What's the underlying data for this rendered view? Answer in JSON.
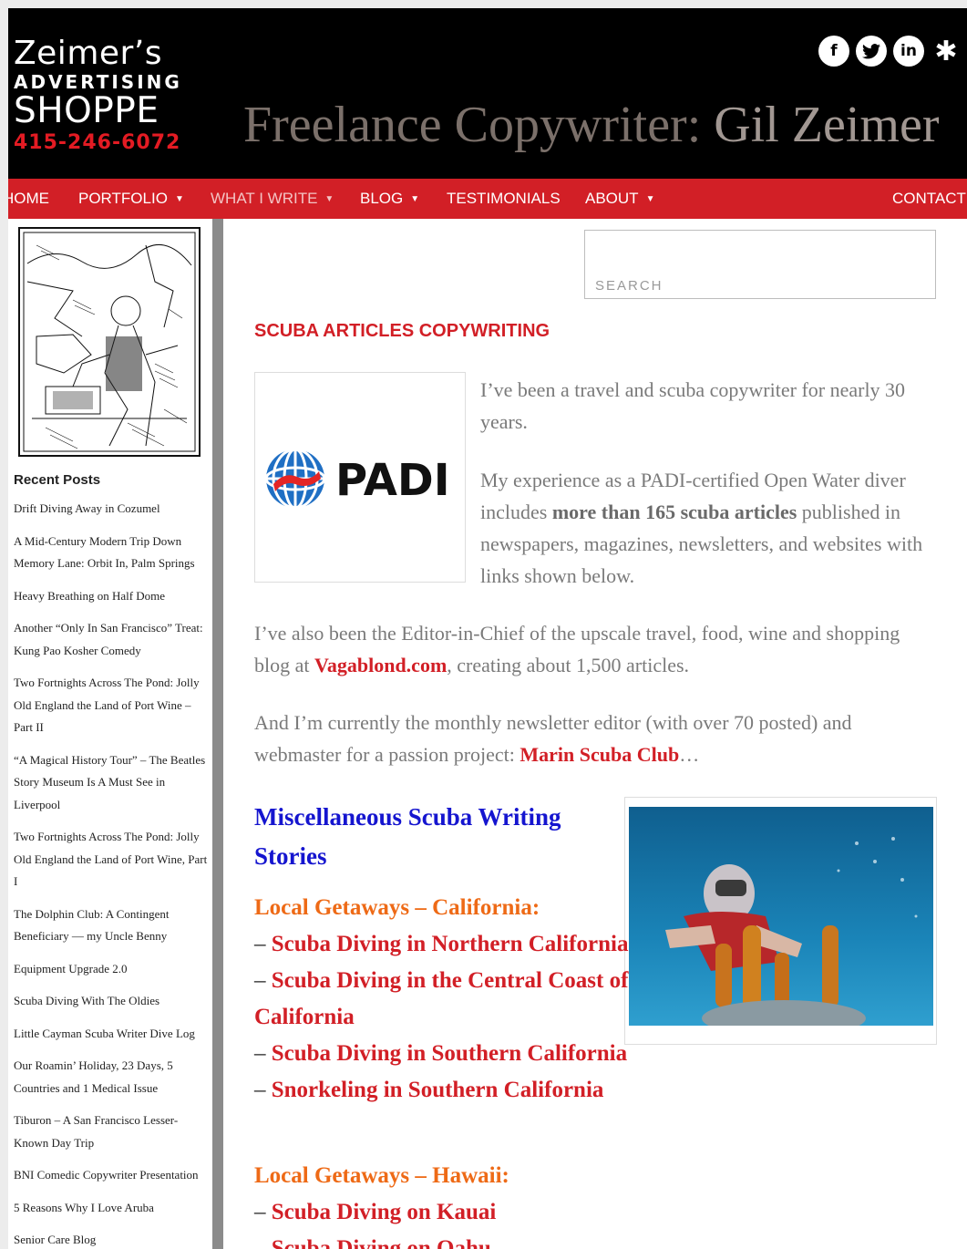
{
  "logo": {
    "line1": "Zeimer’s",
    "line2": "ADVERTISING",
    "line3": "SHOPPE",
    "phone": "415-246-6072"
  },
  "site_title": {
    "part1": "Freelance Copywriter: ",
    "part2": "Gil Zeimer"
  },
  "social": [
    {
      "name": "facebook-icon",
      "glyph": "f"
    },
    {
      "name": "twitter-icon",
      "glyph": "t"
    },
    {
      "name": "linkedin-icon",
      "glyph": "in"
    },
    {
      "name": "yelp-icon",
      "glyph": "✱"
    }
  ],
  "nav": {
    "home": "HOME",
    "portfolio": "PORTFOLIO",
    "what_i_write": "WHAT I WRITE",
    "blog": "BLOG",
    "testimonials": "TESTIMONIALS",
    "about": "ABOUT",
    "contact": "CONTACT"
  },
  "sidebar": {
    "recent_title": "Recent Posts",
    "recent_posts": [
      "Drift Diving Away in Cozumel",
      "A Mid-Century Modern Trip Down Memory Lane: Orbit In, Palm Springs",
      "Heavy Breathing on Half Dome",
      "Another “Only In San Francisco” Treat: Kung Pao Kosher Comedy",
      "Two Fortnights Across The Pond: Jolly Old England the Land of Port Wine – Part II",
      "“A Magical History Tour” – The Beatles Story Museum Is A Must See in Liverpool",
      "Two Fortnights Across The Pond: Jolly Old England the Land of Port Wine, Part I",
      "The Dolphin Club: A Contingent Beneficiary — my Uncle Benny",
      "Equipment Upgrade 2.0",
      "Scuba Diving With The Oldies",
      "Little Cayman Scuba Writer Dive Log",
      "Our Roamin’ Holiday, 23 Days, 5 Countries and 1 Medical Issue",
      "Tiburon – A San Francisco Lesser-Known Day Trip",
      "BNI Comedic Copywriter Presentation",
      "5 Reasons Why I Love Aruba",
      "Senior Care Blog"
    ]
  },
  "search": {
    "placeholder": "SEARCH"
  },
  "main": {
    "heading": "SCUBA ARTICLES COPYWRITING",
    "padi_logo_text": "PADI",
    "intro1": "I’ve been a travel and scuba copywriter for nearly 30 years.",
    "intro2_a": "My experience as a PADI-certified Open Water diver includes ",
    "intro2_bold": "more than 165 scuba articles",
    "intro2_b": " published in newspapers, magazines, newsletters, and websites with links shown below.",
    "intro3_a": "I’ve also been the Editor-in-Chief of the upscale travel, food, wine and shopping blog at ",
    "intro3_link": "Vagablond.com",
    "intro3_b": ", creating about 1,500 articles.",
    "intro4_a": "And I’m currently the monthly newsletter editor (with over 70 posted) and webmaster for a passion project: ",
    "intro4_link": "Marin Scuba Club",
    "intro4_b": "…",
    "misc_heading": "Miscellaneous Scuba Writing Stories",
    "dash": "– ",
    "cal_heading": "Local Getaways – California:",
    "cal_links": [
      "Scuba Diving in Northern California",
      "Scuba Diving in the Central Coast of California",
      "Scuba Diving in Southern California",
      "Snorkeling in Southern California"
    ],
    "haw_heading": "Local Getaways – Hawaii:",
    "haw_links": [
      "Scuba Diving on Kauai",
      "Scuba Diving on Oahu"
    ]
  },
  "colors": {
    "nav_red": "#d21f26",
    "link_red": "#d21f26",
    "heading_blue": "#1515cf",
    "heading_orange": "#ee6a16"
  }
}
